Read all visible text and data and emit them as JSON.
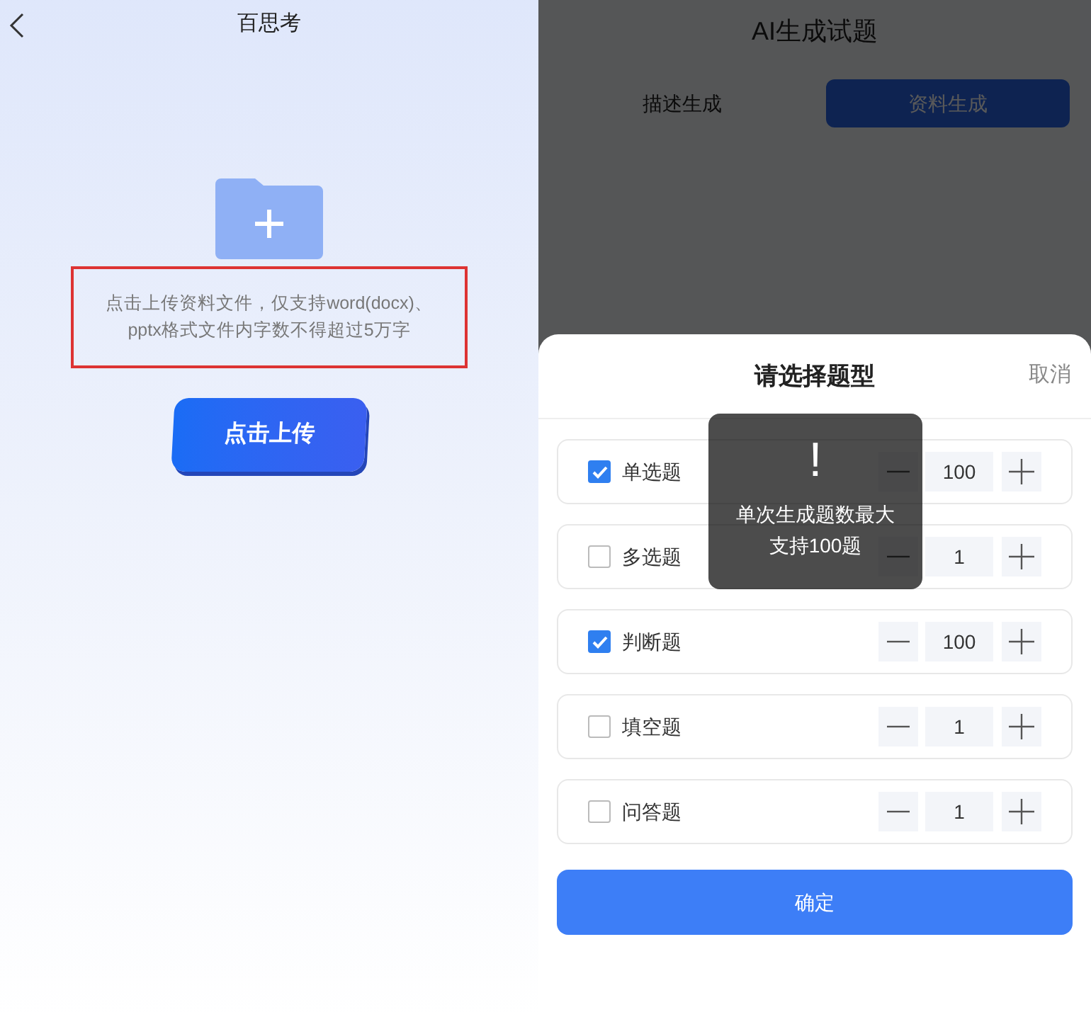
{
  "upload_page": {
    "title": "百思考",
    "hint": "点击上传资料文件，仅支持word(docx)、pptx格式文件内字数不得超过5万字",
    "upload_button": "点击上传"
  },
  "generate_page": {
    "title": "AI生成试题",
    "tabs": [
      {
        "label": "描述生成",
        "selected": false
      },
      {
        "label": "资料生成",
        "selected": true
      }
    ]
  },
  "sheet": {
    "title": "请选择题型",
    "cancel": "取消",
    "rows": [
      {
        "label": "单选题",
        "checked": true,
        "count": "100"
      },
      {
        "label": "多选题",
        "checked": false,
        "count": "1"
      },
      {
        "label": "判断题",
        "checked": true,
        "count": "100"
      },
      {
        "label": "填空题",
        "checked": false,
        "count": "1"
      },
      {
        "label": "问答题",
        "checked": false,
        "count": "1"
      }
    ],
    "confirm": "确定"
  },
  "toast": {
    "icon": "!",
    "message": "单次生成题数最大支持100题"
  }
}
